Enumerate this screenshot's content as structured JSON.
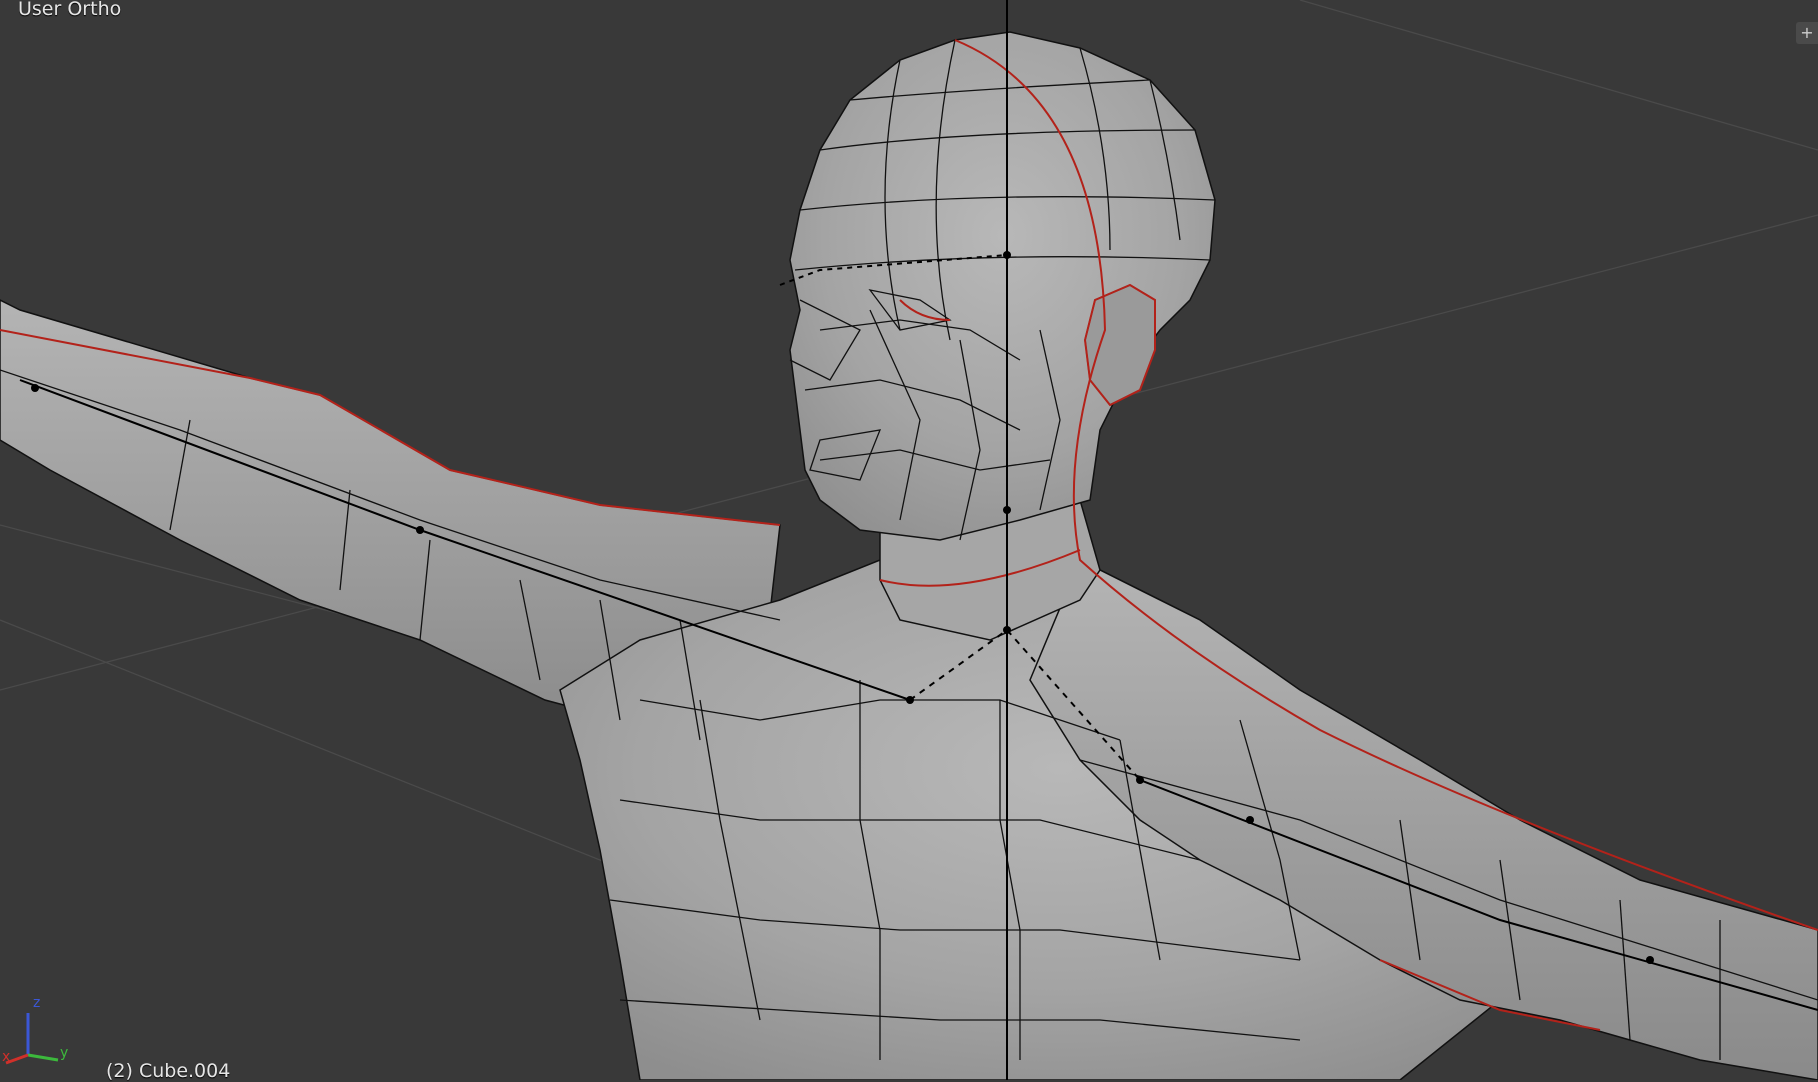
{
  "viewport": {
    "view_name": "User Ortho",
    "object_info": "(2) Cube.004",
    "corner_widget_icon": "plus-icon",
    "background_color": "#393939",
    "mesh_color": "#a8a8a8",
    "wire_color": "#111111",
    "seam_color": "#b3221a"
  },
  "gizmo": {
    "x_label": "x",
    "y_label": "y",
    "z_label": "z",
    "x_color": "#d0302a",
    "y_color": "#3cb93c",
    "z_color": "#3b57d6"
  }
}
